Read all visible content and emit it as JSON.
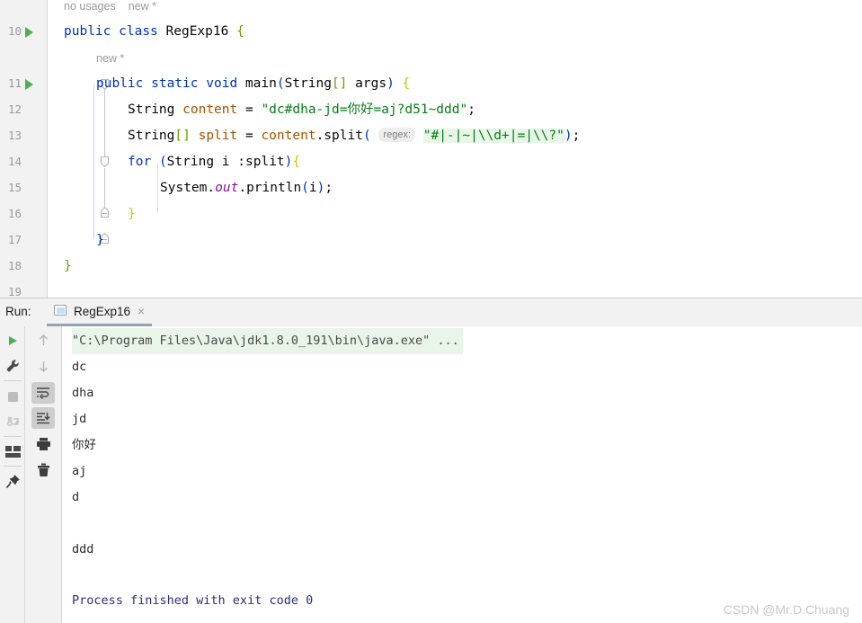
{
  "editor": {
    "gutter": {
      "lines": [
        {
          "num": "10",
          "run_arrow": true,
          "fold": "none"
        },
        {
          "num": "11",
          "run_arrow": true,
          "fold": "collapse-open"
        },
        {
          "num": "12",
          "run_arrow": false,
          "fold": "none"
        },
        {
          "num": "13",
          "run_arrow": false,
          "fold": "none"
        },
        {
          "num": "14",
          "run_arrow": false,
          "fold": "collapse-open"
        },
        {
          "num": "15",
          "run_arrow": false,
          "fold": "none"
        },
        {
          "num": "16",
          "run_arrow": false,
          "fold": "end"
        },
        {
          "num": "17",
          "run_arrow": false,
          "fold": "end"
        },
        {
          "num": "18",
          "run_arrow": false,
          "fold": "none"
        },
        {
          "num": "19",
          "run_arrow": false,
          "fold": "none"
        }
      ]
    },
    "hints": {
      "no_usages": "no usages",
      "new_star_class": "new *",
      "new_star_method": "new *"
    },
    "code": {
      "line10": {
        "kw_public": "public",
        "kw_class": "class",
        "class_name": "RegExp16",
        "brace": "{"
      },
      "line11": {
        "kw_public": "public",
        "kw_static": "static",
        "kw_void": "void",
        "method": "main",
        "paren_open": "(",
        "type_string": "String",
        "brackets": "[]",
        "arg": "args",
        "paren_close": ")",
        "brace": "{"
      },
      "line12": {
        "type": "String",
        "var": "content",
        "eq": "=",
        "string": "\"dc#dha-jd=你好=aj?d51~ddd\"",
        "semi": ";"
      },
      "line13": {
        "type": "String",
        "brackets": "[]",
        "var": "split",
        "eq": "=",
        "obj": "content",
        "dot": ".",
        "method": "split",
        "paren_open": "(",
        "param_hint": "regex:",
        "regex_string": "\"#|-|~|\\\\d+|=|\\\\?\"",
        "paren_close": ")",
        "semi": ";"
      },
      "line14": {
        "kw_for": "for",
        "paren_open": "(",
        "type": "String",
        "var": "i",
        "colon": " :",
        "iterable": "split",
        "paren_close": ")",
        "brace": "{"
      },
      "line15": {
        "system": "System",
        "dot1": ".",
        "out": "out",
        "dot2": ".",
        "println": "println",
        "paren_open": "(",
        "arg": "i",
        "paren_close": ")",
        "semi": ";"
      },
      "line16": {
        "brace": "}"
      },
      "line17": {
        "brace": "}"
      },
      "line18": {
        "brace": "}"
      }
    }
  },
  "run_panel": {
    "label": "Run:",
    "tab": {
      "icon": "console-window-icon",
      "name": "RegExp16",
      "close": "×"
    },
    "left_toolbar": [
      {
        "name": "rerun-button",
        "icon": "play-icon",
        "enabled": true
      },
      {
        "name": "settings-button",
        "icon": "wrench-icon",
        "enabled": true
      },
      {
        "name": "stop-button",
        "icon": "stop-square-icon",
        "enabled": false
      },
      {
        "name": "resume-program-button",
        "icon": "rerun-failed-icon",
        "enabled": false
      },
      {
        "name": "layout-button",
        "icon": "layout-icon",
        "enabled": true
      },
      {
        "name": "pin-tab-button",
        "icon": "pin-icon",
        "enabled": true
      }
    ],
    "console_toolbar": [
      {
        "name": "prev-occurrence-button",
        "icon": "arrow-up-icon",
        "pressed": false
      },
      {
        "name": "next-occurrence-button",
        "icon": "arrow-down-icon",
        "pressed": false
      },
      {
        "name": "soft-wrap-button",
        "icon": "soft-wrap-icon",
        "pressed": true
      },
      {
        "name": "scroll-to-end-button",
        "icon": "scroll-to-end-icon",
        "pressed": true
      },
      {
        "name": "print-button",
        "icon": "printer-icon",
        "pressed": false
      },
      {
        "name": "clear-all-button",
        "icon": "trash-icon",
        "pressed": false
      }
    ],
    "console_output": [
      {
        "text": "\"C:\\Program Files\\Java\\jdk1.8.0_191\\bin\\java.exe\" ...",
        "style": "cmd"
      },
      {
        "text": "dc",
        "style": "normal"
      },
      {
        "text": "dha",
        "style": "normal"
      },
      {
        "text": "jd",
        "style": "normal"
      },
      {
        "text": "你好",
        "style": "normal"
      },
      {
        "text": "aj",
        "style": "normal"
      },
      {
        "text": "d",
        "style": "normal"
      },
      {
        "text": "",
        "style": "normal"
      },
      {
        "text": "ddd",
        "style": "normal"
      },
      {
        "text": "",
        "style": "normal"
      },
      {
        "text": "Process finished with exit code 0",
        "style": "proc"
      }
    ]
  },
  "watermark": "CSDN @Mr.D.Chuang",
  "colors": {
    "keyword": "#0033b3",
    "string": "#067d17",
    "string_highlight_bg": "#e7f6e7",
    "field": "#871094",
    "local_var": "#a35200",
    "gutter_bg": "#f2f2f2",
    "run_arrow": "#4caf50",
    "tab_underline": "#94a2b5",
    "process_text": "#2b2b7f"
  }
}
